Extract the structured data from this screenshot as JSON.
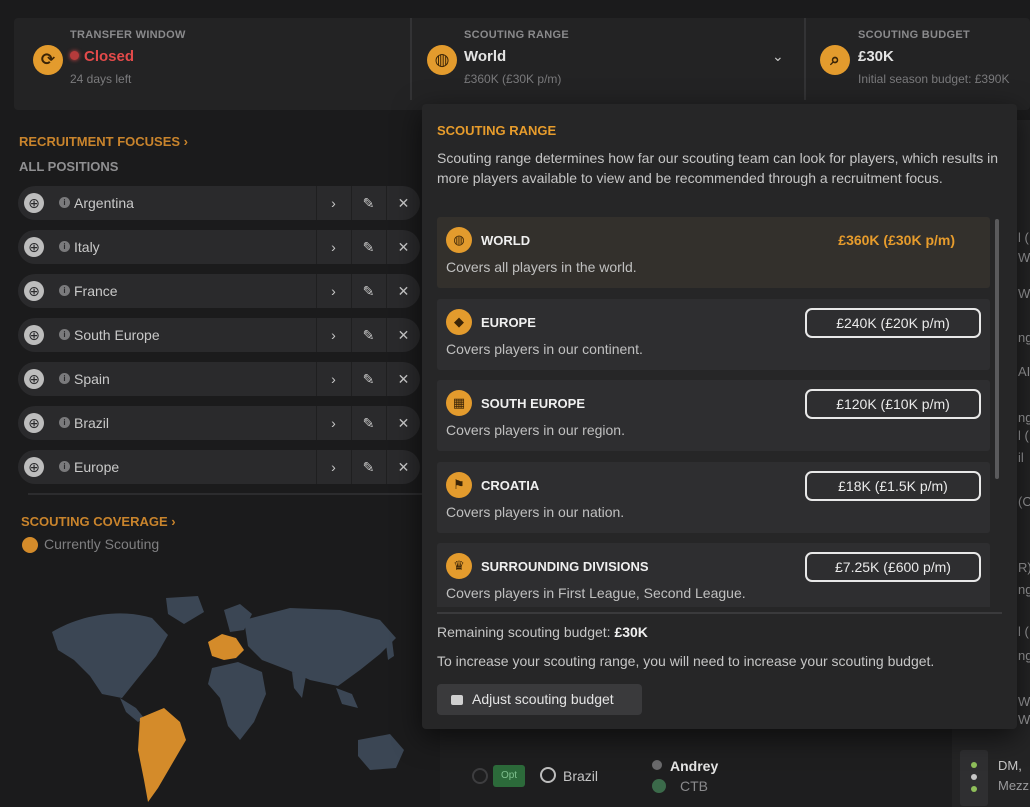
{
  "header": {
    "transfer_window": {
      "label": "TRANSFER WINDOW",
      "status": "Closed",
      "sub": "24 days left"
    },
    "scouting_range": {
      "label": "SCOUTING RANGE",
      "value": "World",
      "sub": "£360K (£30K p/m)"
    },
    "scouting_budget": {
      "label": "SCOUTING BUDGET",
      "value": "£30K",
      "sub": "Initial season budget: £390K"
    }
  },
  "recruitment": {
    "title": "RECRUITMENT FOCUSES",
    "subtitle": "ALL POSITIONS",
    "focuses": [
      {
        "label": "Argentina"
      },
      {
        "label": "Italy"
      },
      {
        "label": "France"
      },
      {
        "label": "South Europe"
      },
      {
        "label": "Spain"
      },
      {
        "label": "Brazil"
      },
      {
        "label": "Europe"
      }
    ]
  },
  "coverage": {
    "title": "SCOUTING COVERAGE",
    "legend": "Currently Scouting",
    "colors": {
      "land": "#3b4654",
      "scouted": "#d48b2a"
    }
  },
  "popup": {
    "title": "SCOUTING RANGE",
    "description": "Scouting range determines how far our scouting team can look for players, which results in more players available to view and be recommended through a recruitment focus.",
    "options": [
      {
        "name": "WORLD",
        "desc": "Covers all players in the world.",
        "cost": "£360K (£30K p/m)",
        "selected": true,
        "icon": "globe-icon"
      },
      {
        "name": "EUROPE",
        "desc": "Covers players in our continent.",
        "cost": "£240K (£20K p/m)",
        "selected": false,
        "icon": "continent-icon"
      },
      {
        "name": "SOUTH EUROPE",
        "desc": "Covers players in our region.",
        "cost": "£120K (£10K p/m)",
        "selected": false,
        "icon": "region-icon"
      },
      {
        "name": "CROATIA",
        "desc": "Covers players in our nation.",
        "cost": "£18K (£1.5K p/m)",
        "selected": false,
        "icon": "flag-icon"
      },
      {
        "name": "SURROUNDING DIVISIONS",
        "desc": "Covers players in First League, Second League.",
        "cost": "£7.25K (£600 p/m)",
        "selected": false,
        "icon": "trophy-icon"
      }
    ],
    "remaining_label": "Remaining scouting budget:",
    "remaining_value": "£30K",
    "note": "To increase your scouting range, you will need to increase your scouting budget.",
    "adjust_button": "Adjust scouting budget"
  },
  "background_row": {
    "opt": "Opt",
    "nation": "Brazil",
    "player": "Andrey",
    "role": "CTB",
    "position": "DM,",
    "position_sub": "Mezz"
  },
  "background_col_fragments": [
    "l (",
    "WM",
    "W",
    "ng",
    "AI",
    "ng",
    "l (",
    "il",
    "(C",
    "R)",
    "ng",
    "l (",
    "ng",
    "W",
    "WB"
  ],
  "colors": {
    "accent": "#e39b2d",
    "closed": "#e34a4a"
  }
}
